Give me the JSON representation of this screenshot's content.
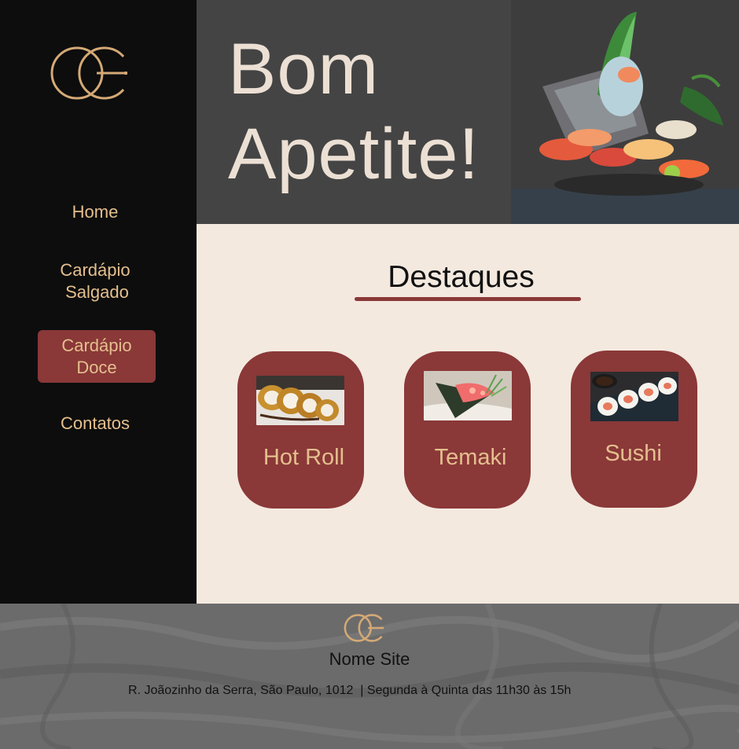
{
  "brand": {
    "logo_icon": "cc-monogram-logo",
    "accent": "#e4bf8e"
  },
  "sidebar": {
    "items": [
      {
        "label": "Home"
      },
      {
        "label_line1": "Cardápio",
        "label_line2": "Salgado"
      },
      {
        "label_line1": "Cardápio",
        "label_line2": "Doce",
        "active": true
      },
      {
        "label": "Contatos"
      }
    ]
  },
  "hero": {
    "title_line1": "Bom",
    "title_line2": "Apetite!",
    "image": "sashimi-platter-image"
  },
  "highlights": {
    "title": "Destaques",
    "cards": [
      {
        "label": "Hot Roll",
        "image": "hot-roll-image"
      },
      {
        "label": "Temaki",
        "image": "temaki-image"
      },
      {
        "label": "Sushi",
        "image": "sushi-image"
      }
    ]
  },
  "footer": {
    "site_name": "Nome Site",
    "address": "R. Joãozinho da Serra, São Paulo, 1012  | Segunda à Quinta das 11h30 às 15h"
  },
  "colors": {
    "sidebar_bg": "#0d0d0d",
    "hero_bg": "#444444",
    "main_bg": "#f4e9df",
    "card_bg": "#8a3838",
    "text_gold": "#e4bf8e",
    "footer_bg": "#6a6a6a"
  }
}
